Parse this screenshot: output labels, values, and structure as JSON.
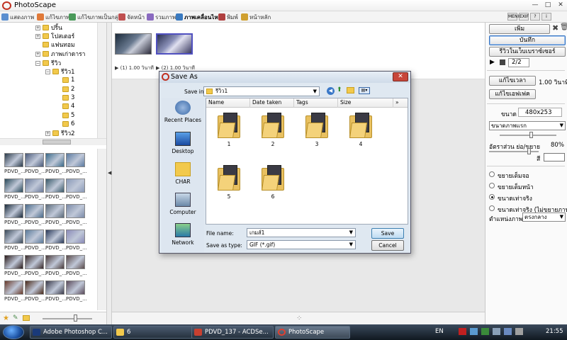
{
  "window": {
    "title": "PhotoScape"
  },
  "tabs": [
    {
      "label": "แสดงภาพ",
      "active": false
    },
    {
      "label": "แก้ไขภาพ",
      "active": false
    },
    {
      "label": "แก้ไขภาพเป็นกลุ่ม",
      "active": false
    },
    {
      "label": "จัดหน้า",
      "active": false
    },
    {
      "label": "รวมภาพ",
      "active": false
    },
    {
      "label": "ภาพเคลื่อนไหว",
      "active": true
    },
    {
      "label": "พิมพ์",
      "active": false
    },
    {
      "label": "หน้าหลัก",
      "active": false
    }
  ],
  "toolbar_right": {
    "menu": "MENU",
    "exif": "EXIF"
  },
  "tree": [
    {
      "label": "ปริ้น",
      "indent": 0
    },
    {
      "label": "โปสเตอร์",
      "indent": 0
    },
    {
      "label": "แฟนทอม",
      "indent": 0
    },
    {
      "label": "ภาพเก่าดารา",
      "indent": 0
    },
    {
      "label": "รีวิว",
      "indent": 0
    },
    {
      "label": "รีวิว1",
      "indent": 1
    },
    {
      "label": "1",
      "indent": 2
    },
    {
      "label": "2",
      "indent": 2
    },
    {
      "label": "3",
      "indent": 2
    },
    {
      "label": "4",
      "indent": 2
    },
    {
      "label": "5",
      "indent": 2
    },
    {
      "label": "6",
      "indent": 2
    },
    {
      "label": "รีวิว2",
      "indent": 1
    }
  ],
  "thumb_label": "PDVD_...",
  "thumb_colors": [
    "#2a3a4a",
    "#4a5a7a",
    "#3a6a8a",
    "#5a7aa0",
    "#2a4a5a",
    "#6a7a9a",
    "#3a5a6a",
    "#8a9ab8",
    "#1a2a3a",
    "#4a6a8a",
    "#5a6a7a",
    "#7a8aa8",
    "#3a4a5a",
    "#5a7a9a",
    "#2a3a5a",
    "#8a8ab8",
    "#2a1a1a",
    "#3a2a2a",
    "#4a3a3a",
    "#5a4a4a",
    "#6a3a2a",
    "#4a2a1a",
    "#3a3a4a",
    "#5a4a5a"
  ],
  "frames": [
    {
      "caption": "(1) 1.00 วินาที"
    },
    {
      "caption": "(2) 1.00 วินาที"
    }
  ],
  "right_panel": {
    "add": "เพิ่ม",
    "save": "บันทึก",
    "preview_web": "รีวิวในเว็บเบราซ์เซอร์",
    "frame_counter": "2/2",
    "edit_time": "แก้ไขเวลา",
    "time_value": "1.00 วินาที",
    "edit_effect": "แก้ไขเอฟเฟค",
    "size_label": "ขนาด",
    "size_value": "480x253",
    "first_frame_size": "ขนาดภาพแรก",
    "ratio_label": "อัตราส่วน ย่อ/ขยาย",
    "ratio_value": "80%",
    "ratio_fraction": 0.8,
    "color_label": "สี",
    "radios": [
      {
        "label": "ขยายเต็มจอ",
        "checked": false
      },
      {
        "label": "ขยายเต็มหน้า",
        "checked": false
      },
      {
        "label": "ขนาดเท่าจริง",
        "checked": true
      },
      {
        "label": "ขนาดเท่าจริง (ไม่ขยายภาพ",
        "checked": false
      }
    ],
    "position_label": "ตำแหน่งภาพ",
    "position_value": "ตรงกลาง"
  },
  "dialog": {
    "title": "Save As",
    "save_in_label": "Save in:",
    "save_in_value": "รีวิว1",
    "places": [
      "Recent Places",
      "Desktop",
      "CHAR",
      "Computer",
      "Network"
    ],
    "columns": [
      "Name",
      "Date taken",
      "Tags",
      "Size"
    ],
    "files": [
      "1",
      "2",
      "3",
      "4",
      "5",
      "6"
    ],
    "file_name_label": "File name:",
    "file_name_value": "เกมส์1",
    "save_type_label": "Save as type:",
    "save_type_value": "GIF (*.gif)",
    "save_button": "Save",
    "cancel_button": "Cancel"
  },
  "taskbar": {
    "tasks": [
      {
        "label": "Adobe Photoshop C...",
        "active": false
      },
      {
        "label": "6",
        "active": false
      },
      {
        "label": "PDVD_137 - ACDSe...",
        "active": false
      },
      {
        "label": "PhotoScape",
        "active": true
      }
    ],
    "lang": "EN",
    "clock": "21:55"
  }
}
